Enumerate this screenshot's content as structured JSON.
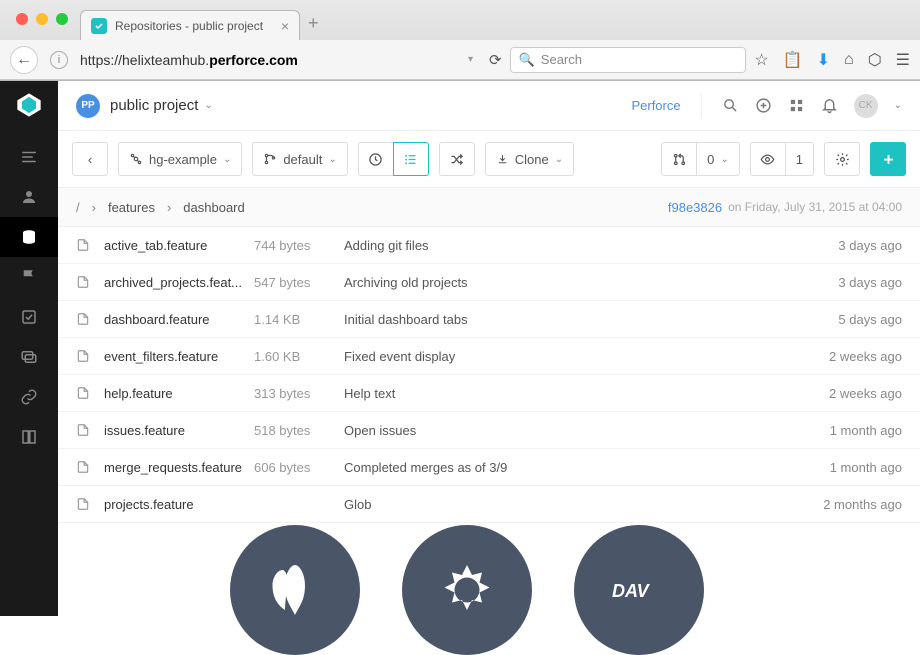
{
  "browser": {
    "tab_title": "Repositories - public project",
    "url_prefix": "https://helixteamhub.",
    "url_bold": "perforce.com",
    "search_placeholder": "Search"
  },
  "topbar": {
    "project_badge": "PP",
    "project_name": "public project",
    "link": "Perforce",
    "avatar": "CK"
  },
  "toolbar": {
    "repo": "hg-example",
    "branch": "default",
    "clone": "Clone",
    "count_label": "0",
    "views": "1"
  },
  "breadcrumb": {
    "root": "/",
    "seg1": "features",
    "seg2": "dashboard",
    "commit": "f98e3826",
    "date": "on Friday, July 31, 2015 at 04:00"
  },
  "files": [
    {
      "name": "active_tab.feature",
      "size": "744 bytes",
      "msg": "Adding git files",
      "date": "3 days ago"
    },
    {
      "name": "archived_projects.feat...",
      "size": "547 bytes",
      "msg": "Archiving old projects",
      "date": "3 days ago"
    },
    {
      "name": "dashboard.feature",
      "size": "1.14 KB",
      "msg": "Initial dashboard tabs",
      "date": "5 days ago"
    },
    {
      "name": "event_filters.feature",
      "size": "1.60 KB",
      "msg": "Fixed event display",
      "date": "2 weeks ago"
    },
    {
      "name": "help.feature",
      "size": "313 bytes",
      "msg": "Help text",
      "date": "2 weeks ago"
    },
    {
      "name": "issues.feature",
      "size": "518 bytes",
      "msg": "Open issues",
      "date": "1 month ago"
    },
    {
      "name": "merge_requests.feature",
      "size": "606 bytes",
      "msg": "Completed merges as of 3/9",
      "date": "1 month ago"
    },
    {
      "name": "projects.feature",
      "size": "",
      "msg": "Glob",
      "date": "2 months ago"
    }
  ]
}
